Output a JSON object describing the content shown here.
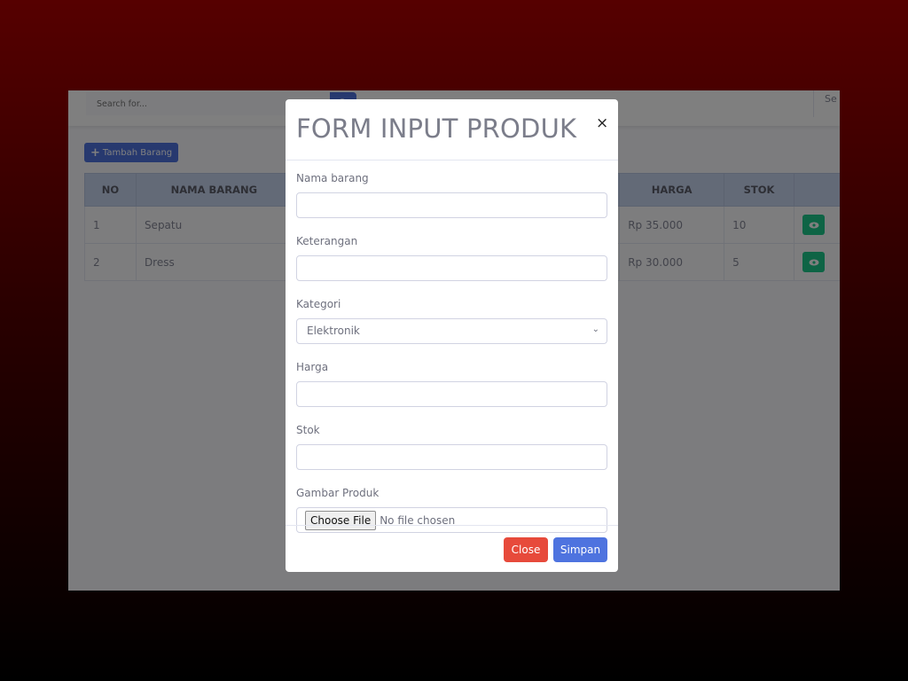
{
  "topbar": {
    "search_placeholder": "Search for...",
    "user_text": "Se"
  },
  "toolbar": {
    "add_label": "Tambah Barang"
  },
  "table": {
    "headers": [
      "NO",
      "NAMA BARANG",
      "HARGA",
      "STOK"
    ],
    "rows": [
      {
        "no": "1",
        "name": "Sepatu",
        "price": "Rp 35.000",
        "stock": "10"
      },
      {
        "no": "2",
        "name": "Dress",
        "price": "Rp 30.000",
        "stock": "5"
      }
    ]
  },
  "modal": {
    "title": "FORM INPUT PRODUK",
    "close_glyph": "×",
    "fields": {
      "name_label": "Nama barang",
      "name_value": "",
      "desc_label": "Keterangan",
      "desc_value": "",
      "category_label": "Kategori",
      "category_selected": "Elektronik",
      "price_label": "Harga",
      "price_value": "",
      "stock_label": "Stok",
      "stock_value": "",
      "image_label": "Gambar Produk",
      "file_button": "Choose File",
      "file_status": "No file chosen"
    },
    "footer": {
      "close_label": "Close",
      "save_label": "Simpan"
    }
  },
  "colors": {
    "primary": "#4e73df",
    "danger": "#e74a3b",
    "success": "#1cc88a"
  }
}
